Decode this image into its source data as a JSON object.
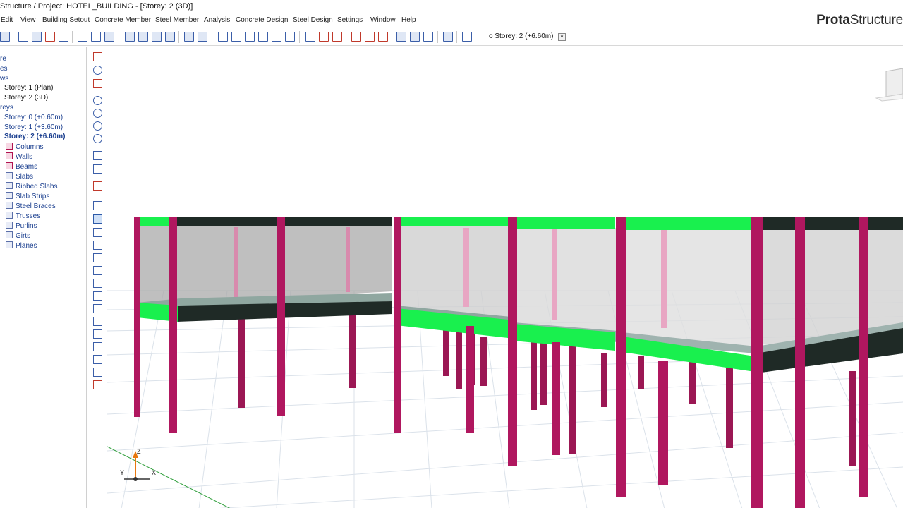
{
  "window": {
    "title": "Structure / Project: HOTEL_BUILDING - [Storey: 2 (3D)]"
  },
  "menu": [
    "Edit",
    "View",
    "Building Setout",
    "Concrete Member",
    "Steel Member",
    "Analysis",
    "Concrete Design",
    "Steel Design",
    "Settings",
    "Window",
    "Help"
  ],
  "brand": {
    "bold": "Prota",
    "rest": "Structure"
  },
  "toolbar": {
    "storey_selector": "o  Storey: 2 (+6.60m)",
    "dropdown_arrow": "▾"
  },
  "tree": {
    "root_items": [
      "re",
      "es",
      "ws"
    ],
    "views": [
      "Storey: 1 (Plan)",
      "Storey: 2 (3D)"
    ],
    "storeys_header": "reys",
    "storeys": [
      "Storey: 0 (+0.60m)",
      "Storey: 1 (+3.60m)",
      "Storey: 2 (+6.60m)"
    ],
    "members": [
      "Columns",
      "Walls",
      "Beams",
      "Slabs",
      "Ribbed Slabs",
      "Slab Strips",
      "Steel Braces",
      "Trusses",
      "Purlins",
      "Girts",
      "Planes"
    ]
  },
  "axes": {
    "z": "Z",
    "y": "Y",
    "x": "X"
  },
  "colors": {
    "column": "#b0175f",
    "beam_highlight": "#19f04e",
    "beam_dark": "#1f2a26",
    "slab": "#8fa7a0",
    "glass": "#d4d4d4",
    "grid": "#d6dde6"
  }
}
